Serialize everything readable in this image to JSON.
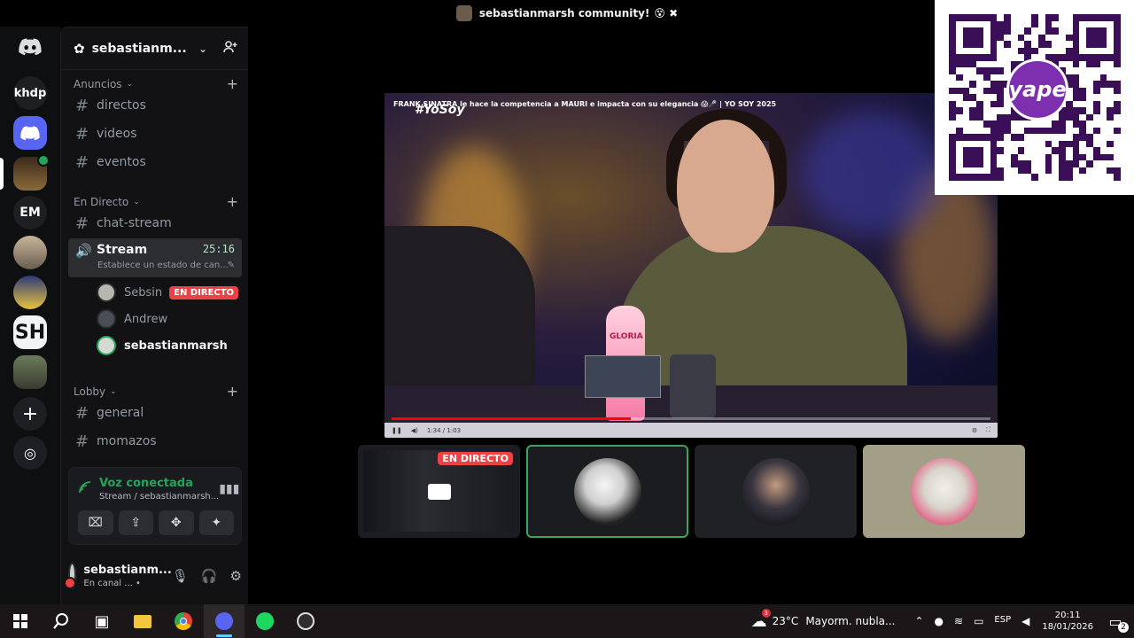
{
  "window": {
    "title": "sebastianmarsh community!",
    "title_emoji": "😵 ✖"
  },
  "servers": [
    {
      "label": "khdp"
    },
    {
      "label": "EM"
    },
    {
      "label": "SH"
    }
  ],
  "guild": {
    "name": "sebastianm...",
    "invite_icon": "add-member-icon"
  },
  "categories": [
    {
      "name": "Anuncios",
      "channels": [
        "directos",
        "videos",
        "eventos"
      ]
    },
    {
      "name": "En Directo",
      "channels": [
        "chat-stream"
      ]
    },
    {
      "name": "Lobby",
      "channels": [
        "general",
        "momazos"
      ]
    }
  ],
  "stream_channel": {
    "name": "Stream",
    "timer": "25:16",
    "status": "Establece un estado de can..."
  },
  "voice_users": [
    {
      "name": "Sebsin",
      "badge": "EN DIRECTO"
    },
    {
      "name": "Andrew"
    },
    {
      "name": "sebastianmarsh"
    }
  ],
  "voice_panel": {
    "title": "Voz conectada",
    "subtitle": "Stream / sebastianmarsh..."
  },
  "user": {
    "name": "sebastianm...",
    "status": "En canal ... •"
  },
  "video": {
    "title": "FRANK SINATRA le hace la competencia a MAURI e impacta con su elegancia 😱🎤 | YO SOY 2025",
    "logo": "#YoSoy",
    "time": "1:34 / 1:03",
    "progress": 0.4,
    "bottle_label": "GLORIA"
  },
  "tiles": [
    {
      "badge": "EN DIRECTO"
    }
  ],
  "qr": {
    "brand": "yape"
  },
  "taskbar": {
    "weather_temp": "23°C",
    "weather_text": "Mayorm. nubla...",
    "weather_alert": "3",
    "lang": "ESP",
    "time": "20:11",
    "date": "18/01/2026",
    "notif_count": "2"
  }
}
